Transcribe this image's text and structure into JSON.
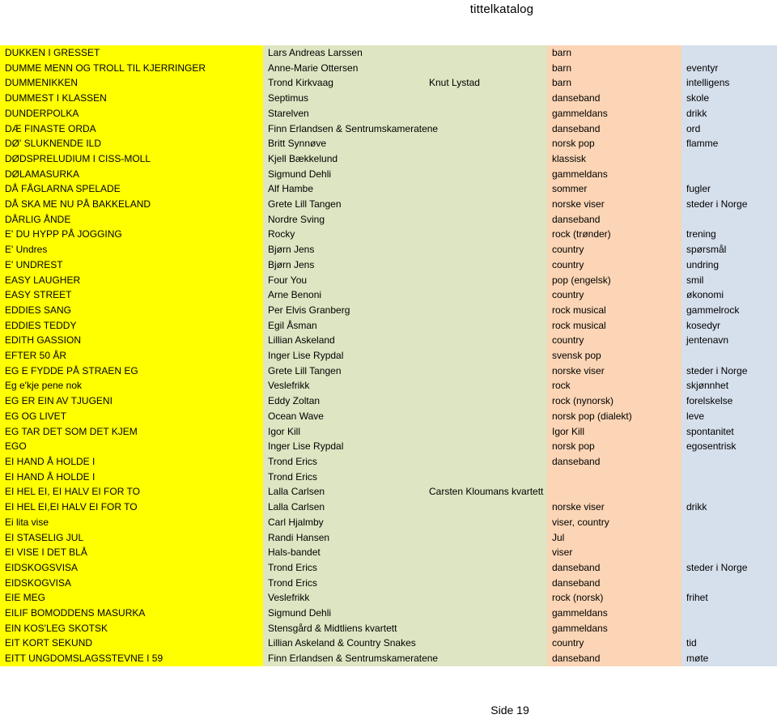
{
  "document": {
    "title": "tittelkatalog",
    "footer": "Side 19"
  },
  "colors": {
    "title_column": "#ffff00",
    "artist_column": "#dde5c2",
    "genre_column": "#fbd5b5",
    "theme_column": "#d6dfec",
    "page_background": "#ffffff",
    "text": "#000000"
  },
  "table": {
    "columns": [
      "title",
      "artist",
      "artist2",
      "genre",
      "theme"
    ],
    "rows": [
      {
        "title": "DUKKEN I GRESSET",
        "artist": "Lars Andreas Larssen",
        "artist2": "",
        "genre": "barn",
        "theme": ""
      },
      {
        "title": "DUMME MENN OG TROLL TIL KJERRINGER",
        "artist": "Anne-Marie Ottersen",
        "artist2": "",
        "genre": "barn",
        "theme": "eventyr"
      },
      {
        "title": "DUMMENIKKEN",
        "artist": "Trond Kirkvaag",
        "artist2": "Knut Lystad",
        "genre": "barn",
        "theme": "intelligens"
      },
      {
        "title": "DUMMEST I KLASSEN",
        "artist": "Septimus",
        "artist2": "",
        "genre": "danseband",
        "theme": "skole"
      },
      {
        "title": "DUNDERPOLKA",
        "artist": "Starelven",
        "artist2": "",
        "genre": "gammeldans",
        "theme": "drikk"
      },
      {
        "title": "DÆ FINASTE ORDA",
        "artist": "Finn Erlandsen & Sentrumskameratene",
        "artist2": "",
        "genre": "danseband",
        "theme": "ord"
      },
      {
        "title": "DØ' SLUKNENDE ILD",
        "artist": "Britt Synnøve",
        "artist2": "",
        "genre": "norsk pop",
        "theme": "flamme"
      },
      {
        "title": "DØDSPRELUDIUM I CISS-MOLL",
        "artist": "Kjell Bækkelund",
        "artist2": "",
        "genre": "klassisk",
        "theme": ""
      },
      {
        "title": "DØLAMASURKA",
        "artist": "Sigmund Dehli",
        "artist2": "",
        "genre": "gammeldans",
        "theme": ""
      },
      {
        "title": "DÅ FÅGLARNA SPELADE",
        "artist": "Alf Hambe",
        "artist2": "",
        "genre": "sommer",
        "theme": "fugler"
      },
      {
        "title": "DÅ SKA ME NU PÅ BAKKELAND",
        "artist": "Grete Lill Tangen",
        "artist2": "",
        "genre": "norske viser",
        "theme": "steder i Norge"
      },
      {
        "title": "DÅRLIG ÅNDE",
        "artist": "Nordre Sving",
        "artist2": "",
        "genre": "danseband",
        "theme": ""
      },
      {
        "title": "E' DU HYPP PÅ JOGGING",
        "artist": "Rocky",
        "artist2": "",
        "genre": "rock (trønder)",
        "theme": "trening"
      },
      {
        "title": "E' Undres",
        "artist": "Bjørn Jens",
        "artist2": "",
        "genre": "country",
        "theme": "spørsmål"
      },
      {
        "title": "E' UNDREST",
        "artist": "Bjørn Jens",
        "artist2": "",
        "genre": "country",
        "theme": "undring"
      },
      {
        "title": "EASY LAUGHER",
        "artist": "Four You",
        "artist2": "",
        "genre": "pop (engelsk)",
        "theme": "smil"
      },
      {
        "title": "EASY  STREET",
        "artist": "Arne Benoni",
        "artist2": "",
        "genre": "country",
        "theme": "økonomi"
      },
      {
        "title": "EDDIES SANG",
        "artist": "Per Elvis Granberg",
        "artist2": "",
        "genre": "rock musical",
        "theme": "gammelrock"
      },
      {
        "title": "EDDIES TEDDY",
        "artist": "Egil Åsman",
        "artist2": "",
        "genre": "rock musical",
        "theme": "kosedyr"
      },
      {
        "title": "EDITH GASSION",
        "artist": "Lillian Askeland",
        "artist2": "",
        "genre": "country",
        "theme": "jentenavn"
      },
      {
        "title": "EFTER 50 ÅR",
        "artist": "Inger Lise Rypdal",
        "artist2": "",
        "genre": "svensk pop",
        "theme": ""
      },
      {
        "title": "EG E FYDDE PÅ STRAEN EG",
        "artist": "Grete Lill Tangen",
        "artist2": "",
        "genre": "norske viser",
        "theme": "steder i Norge"
      },
      {
        "title": "Eg e'kje pene nok",
        "artist": "Veslefrikk",
        "artist2": "",
        "genre": "rock",
        "theme": "skjønnhet"
      },
      {
        "title": "EG ER EIN AV TJUGENI",
        "artist": "Eddy Zoltan",
        "artist2": "",
        "genre": "rock (nynorsk)",
        "theme": "forelskelse"
      },
      {
        "title": "EG OG LIVET",
        "artist": "Ocean Wave",
        "artist2": "",
        "genre": "norsk pop (dialekt)",
        "theme": "leve"
      },
      {
        "title": "EG TAR DET SOM DET KJEM",
        "artist": "Igor Kill",
        "artist2": "",
        "genre": "Igor Kill",
        "theme": "spontanitet"
      },
      {
        "title": "EGO",
        "artist": "Inger Lise Rypdal",
        "artist2": "",
        "genre": "norsk pop",
        "theme": "egosentrisk"
      },
      {
        "title": "EI HAND Å HOLDE I",
        "artist": "Trond Erics",
        "artist2": "",
        "genre": "danseband",
        "theme": ""
      },
      {
        "title": "EI HAND Å HOLDE I",
        "artist": "Trond Erics",
        "artist2": "",
        "genre": "",
        "theme": ""
      },
      {
        "title": "EI HEL EI, EI HALV EI FOR TO",
        "artist": "Lalla Carlsen",
        "artist2": "Carsten Kloumans kvartett",
        "genre": "",
        "theme": ""
      },
      {
        "title": "EI HEL EI,EI HALV EI FOR TO",
        "artist": "Lalla Carlsen",
        "artist2": "",
        "genre": "norske viser",
        "theme": "drikk"
      },
      {
        "title": "Ei lita vise",
        "artist": "Carl Hjalmby",
        "artist2": "",
        "genre": "viser, country",
        "theme": ""
      },
      {
        "title": "EI STASELIG JUL",
        "artist": "Randi Hansen",
        "artist2": "",
        "genre": "Jul",
        "theme": ""
      },
      {
        "title": "EI VISE I DET BLÅ",
        "artist": "Hals-bandet",
        "artist2": "",
        "genre": "viser",
        "theme": ""
      },
      {
        "title": "EIDSKOGSVISA",
        "artist": "Trond Erics",
        "artist2": "",
        "genre": "danseband",
        "theme": "steder i Norge"
      },
      {
        "title": "EIDSKOGVISA",
        "artist": "Trond Erics",
        "artist2": "",
        "genre": "danseband",
        "theme": ""
      },
      {
        "title": "EIE MEG",
        "artist": "Veslefrikk",
        "artist2": "",
        "genre": "rock (norsk)",
        "theme": "frihet"
      },
      {
        "title": "EILIF BOMODDENS MASURKA",
        "artist": "Sigmund Dehli",
        "artist2": "",
        "genre": "gammeldans",
        "theme": ""
      },
      {
        "title": "EIN KOS'LEG SKOTSK",
        "artist": "Stensgård & Midtliens kvartett",
        "artist2": "",
        "genre": "gammeldans",
        "theme": ""
      },
      {
        "title": "EIT KORT SEKUND",
        "artist": "Lillian Askeland & Country Snakes",
        "artist2": "",
        "genre": "country",
        "theme": "tid"
      },
      {
        "title": "EITT UNGDOMSLAGSSTEVNE I 59",
        "artist": "Finn Erlandsen & Sentrumskameratene",
        "artist2": "",
        "genre": "danseband",
        "theme": "møte"
      }
    ]
  }
}
